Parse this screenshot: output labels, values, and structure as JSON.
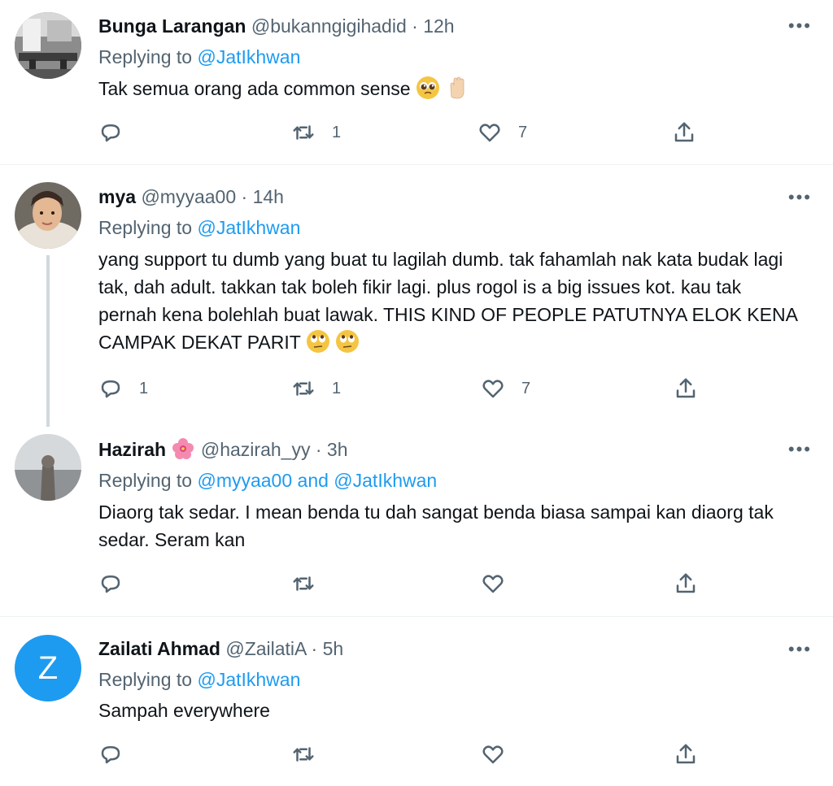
{
  "tweets": [
    {
      "name": "Bunga Larangan",
      "handle": "@bukanngigihadid",
      "sep": "·",
      "time": "12h",
      "replying_prefix": "Replying to",
      "replying_to": "@JatIkhwan",
      "text": "Tak semua orang ada common sense",
      "emoji": [
        "pleading-face-emoji",
        "raised-hand-emoji"
      ],
      "replies": "",
      "retweets": "1",
      "likes": "7"
    },
    {
      "name": "mya",
      "handle": "@myyaa00",
      "sep": "·",
      "time": "14h",
      "replying_prefix": "Replying to",
      "replying_to": "@JatIkhwan",
      "text": "yang support tu dumb yang buat tu lagilah dumb. tak fahamlah nak kata budak lagi tak, dah adult. takkan tak boleh fikir lagi. plus rogol is a big issues kot. kau tak pernah kena bolehlah buat lawak. THIS KIND OF PEOPLE PATUTNYA ELOK KENA CAMPAK DEKAT PARIT",
      "emoji": [
        "eye-roll-emoji",
        "eye-roll-emoji"
      ],
      "replies": "1",
      "retweets": "1",
      "likes": "7"
    },
    {
      "name": "Hazirah",
      "name_emoji": "hibiscus-emoji",
      "handle": "@hazirah_yy",
      "sep": "·",
      "time": "3h",
      "replying_prefix": "Replying to",
      "replying_to": "@myyaa00 and @JatIkhwan",
      "text": "Diaorg tak sedar. I mean benda tu dah sangat benda biasa sampai kan diaorg tak sedar. Seram kan",
      "replies": "",
      "retweets": "",
      "likes": ""
    },
    {
      "name": "Zailati Ahmad",
      "handle": "@ZailatiA",
      "sep": "·",
      "time": "5h",
      "avatar_letter": "Z",
      "replying_prefix": "Replying to",
      "replying_to": "@JatIkhwan",
      "text": "Sampah everywhere",
      "replies": "",
      "retweets": "",
      "likes": ""
    }
  ],
  "more_label": "•••",
  "colors": {
    "accent": "#1d9bf0",
    "secondary": "#536471",
    "text": "#0f1419",
    "avatar_z": "#1d9bf0"
  }
}
